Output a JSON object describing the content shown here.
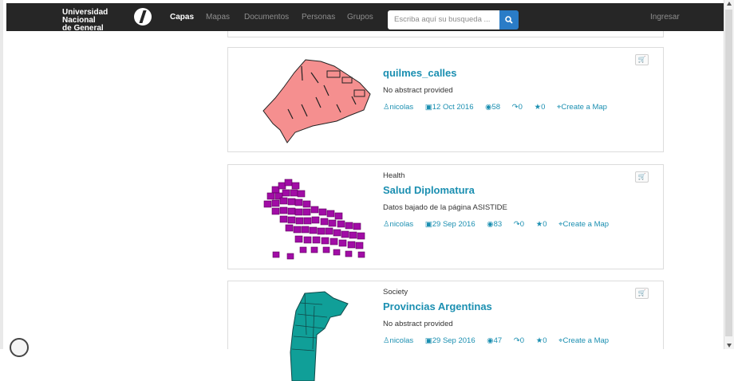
{
  "header": {
    "logo_line1": "Universidad Nacional",
    "logo_line2": "de General Sarmiento",
    "nav": [
      "Capas",
      "Mapas",
      "Documentos",
      "Personas",
      "Grupos"
    ],
    "search_placeholder": "Escriba aquí su busqueda ...",
    "login": "Ingresar"
  },
  "cards": [
    {
      "category": "",
      "title": "quilmes_calles",
      "abstract": "No abstract provided",
      "owner": "nicolas",
      "date": "12 Oct 2016",
      "views": "58",
      "shares": "0",
      "rating": "0",
      "action": "Create a Map",
      "thumb_color": "#f58f8f"
    },
    {
      "category": "Health",
      "title": "Salud Diplomatura",
      "abstract": "Datos bajado de la página ASISTIDE",
      "owner": "nicolas",
      "date": "29 Sep 2016",
      "views": "83",
      "shares": "0",
      "rating": "0",
      "action": "Create a Map",
      "thumb_color": "#a10ca6"
    },
    {
      "category": "Society",
      "title": "Provincias Argentinas",
      "abstract": "No abstract provided",
      "owner": "nicolas",
      "date": "29 Sep 2016",
      "views": "47",
      "shares": "0",
      "rating": "0",
      "action": "Create a Map",
      "thumb_color": "#109f98"
    }
  ]
}
